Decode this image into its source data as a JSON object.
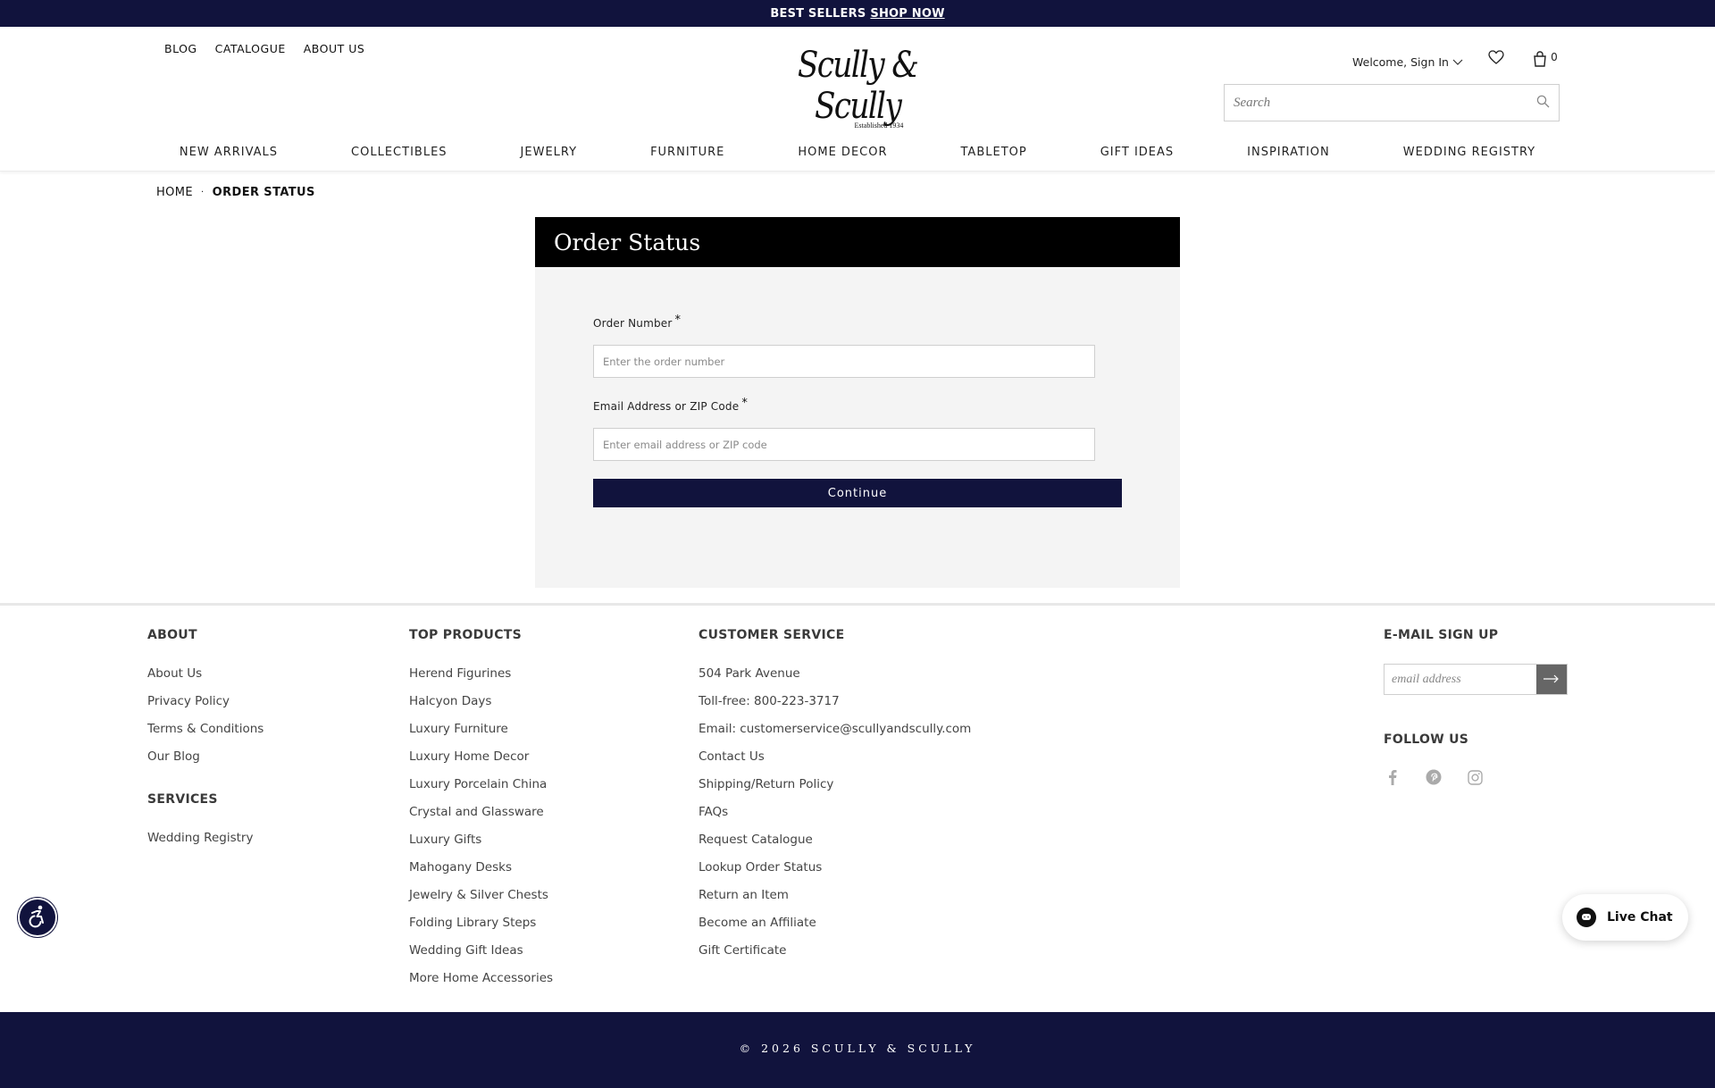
{
  "promo": {
    "text": "BEST SELLERS",
    "link": "SHOP NOW"
  },
  "header": {
    "top_links": [
      "BLOG",
      "CATALOGUE",
      "ABOUT US"
    ],
    "logo_text": "Scully & Scully",
    "logo_tagline": "Established 1934",
    "account_label": "Welcome, Sign In",
    "cart_count": "0",
    "search_placeholder": "Search"
  },
  "nav": [
    "NEW ARRIVALS",
    "COLLECTIBLES",
    "JEWELRY",
    "FURNITURE",
    "HOME DECOR",
    "TABLETOP",
    "GIFT IDEAS",
    "INSPIRATION",
    "WEDDING REGISTRY"
  ],
  "breadcrumb": {
    "home": "HOME",
    "separator": "·",
    "current": "ORDER STATUS"
  },
  "order_form": {
    "title": "Order Status",
    "order_number_label": "Order Number",
    "order_number_placeholder": "Enter the order number",
    "email_label": "Email Address or ZIP Code",
    "email_placeholder": "Enter email address or ZIP code",
    "required_mark": "*",
    "continue_label": "Continue"
  },
  "footer": {
    "about": {
      "heading": "ABOUT",
      "items": [
        "About Us",
        "Privacy Policy",
        "Terms & Conditions",
        "Our Blog"
      ]
    },
    "services": {
      "heading": "SERVICES",
      "items": [
        "Wedding Registry"
      ]
    },
    "top_products": {
      "heading": "TOP PRODUCTS",
      "items": [
        "Herend Figurines",
        "Halcyon Days",
        "Luxury Furniture",
        "Luxury Home Decor",
        "Luxury Porcelain China",
        "Crystal and Glassware",
        "Luxury Gifts",
        "Mahogany Desks",
        "Jewelry & Silver Chests",
        "Folding Library Steps",
        "Wedding Gift Ideas",
        "More Home Accessories"
      ]
    },
    "customer_service": {
      "heading": "CUSTOMER SERVICE",
      "items": [
        "504 Park Avenue",
        "Toll-free: 800-223-3717",
        "Email: customerservice@scullyandscully.com",
        "Contact Us",
        "Shipping/Return Policy",
        "FAQs",
        "Request Catalogue",
        "Lookup Order Status",
        "Return an Item",
        "Become an Affiliate",
        "Gift Certificate"
      ]
    },
    "email_signup": {
      "heading": "E-MAIL SIGN UP",
      "placeholder": "email address"
    },
    "follow_us": {
      "heading": "FOLLOW US",
      "icons": [
        "facebook-icon",
        "pinterest-icon",
        "instagram-icon"
      ]
    },
    "copyright": "© 2026 SCULLY & SCULLY"
  },
  "widgets": {
    "live_chat_label": "Live Chat"
  },
  "colors": {
    "navy": "#11133d",
    "panel_bg": "#f4f4f4",
    "panel_header": "#000000"
  }
}
